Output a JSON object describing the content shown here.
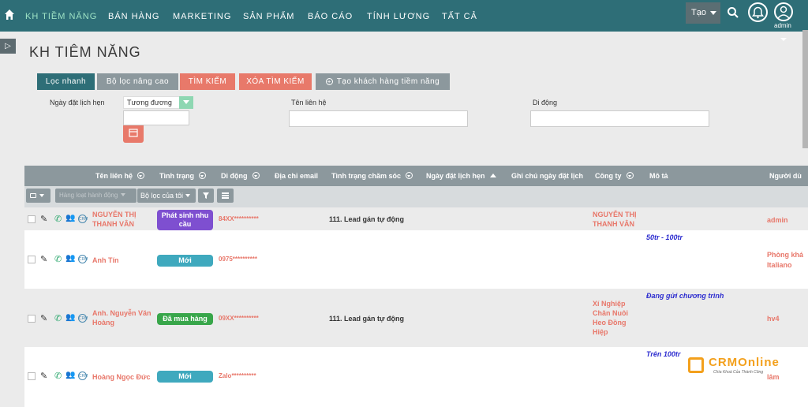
{
  "nav": {
    "menu": [
      "KH TIỀM NĂNG",
      "BÁN HÀNG",
      "MARKETING",
      "SẢN PHẨM",
      "BÁO CÁO",
      "TÍNH LƯƠNG",
      "TẤT CẢ"
    ],
    "create_label": "Tạo",
    "user_label": "admin"
  },
  "page": {
    "title": "KH TIÊM NĂNG"
  },
  "tabs": {
    "quick_filter": "Lọc nhanh",
    "advanced_filter": "Bộ lọc nâng cao",
    "search": "TÌM KIẾM",
    "clear_search": "XÓA TÌM KIẾM",
    "create_lead": "Tạo khách hàng tiềm năng"
  },
  "filters": {
    "appointment_date_label": "Ngày đặt lịch hẹn",
    "appointment_date_operator": "Tương đương",
    "contact_name_label": "Tên liên hệ",
    "mobile_label": "Di động"
  },
  "table": {
    "headers": [
      "Tên liên hệ",
      "Tình trạng",
      "Di động",
      "Địa chỉ email",
      "Tình trạng chăm sóc",
      "Ngày đặt lịch hẹn",
      "Ghi chú ngày đặt lịch",
      "Công ty",
      "Mô tả",
      "Người dù"
    ],
    "toolbar": {
      "bulk_action": "Hàng loạt hành động",
      "my_filter": "Bộ lọc của tôi"
    },
    "rows": [
      {
        "name": "NGUYỄN THỊ THANH VÂN",
        "status": "Phát sinh nhu cầu",
        "status_color": "#7e4fd0",
        "phone": "84XX**********",
        "care": "111. Lead gán tự động",
        "company": "NGUYỄN THỊ THANH VÂN",
        "description": "",
        "person": "admin"
      },
      {
        "name": "Anh Tín",
        "status": "Mới",
        "status_color": "#3fa9be",
        "phone": "0975**********",
        "care": "",
        "company": "",
        "description": "50tr - 100tr",
        "person": "Phòng khá Italiano"
      },
      {
        "name": "Anh. Nguyễn Văn Hoàng",
        "status": "Đã mua hàng",
        "status_color": "#38a64a",
        "phone": "09XX**********",
        "care": "111. Lead gán tự động",
        "company": "Xí Nghiệp Chăn Nuôi Heo Đồng Hiệp",
        "description": "Đang gửi chương trình",
        "person": "hv4"
      },
      {
        "name": "Hoàng Ngọc Đức",
        "status": "Mới",
        "status_color": "#3fa9be",
        "phone": "Zalo**********",
        "care": "",
        "company": "",
        "description": "Trên 100tr",
        "person": "lâm"
      }
    ]
  },
  "watermark": {
    "brand": "CRMOnline",
    "tagline": "Chìa Khoá Của Thành Công"
  }
}
